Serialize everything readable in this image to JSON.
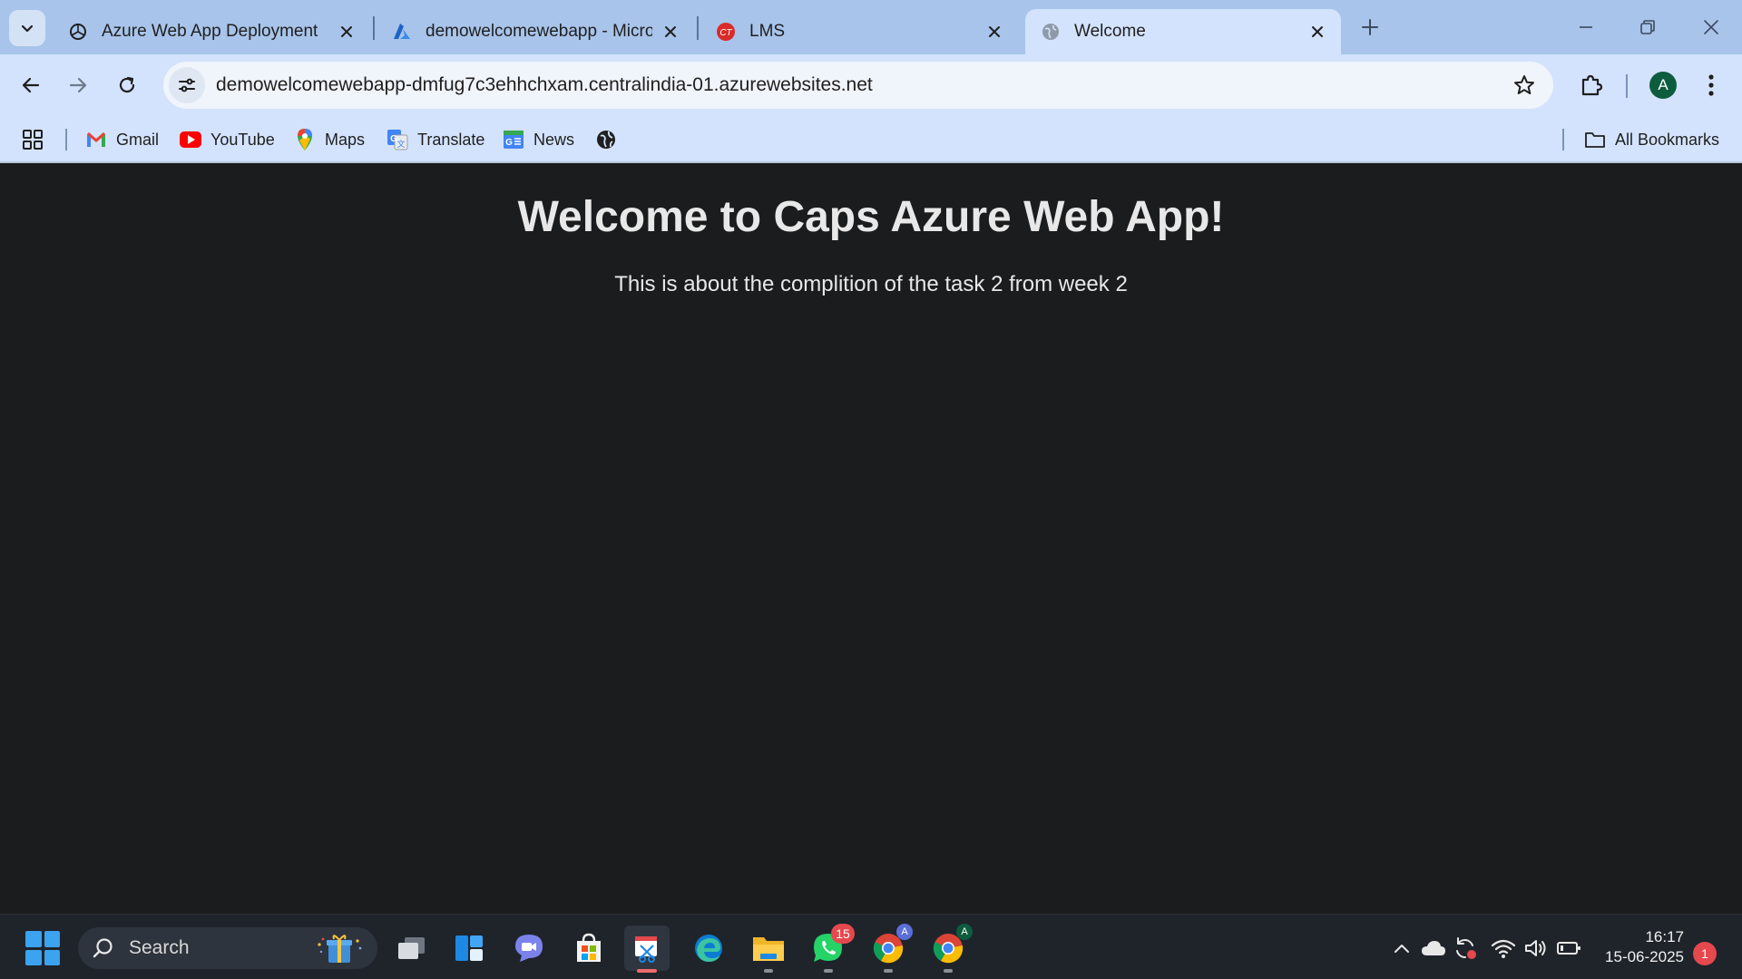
{
  "browser": {
    "tabs": [
      {
        "title": "Azure Web App Deployment",
        "favicon": "openai-icon",
        "active": false
      },
      {
        "title": "demowelcomewebapp - Microsoft Azure",
        "favicon": "azure-icon",
        "active": false
      },
      {
        "title": "LMS",
        "favicon": "lms-icon",
        "active": false
      },
      {
        "title": "Welcome",
        "favicon": "globe-icon",
        "active": true
      }
    ],
    "url": "demowelcomewebapp-dmfug7c3ehhchxam.centralindia-01.azurewebsites.net",
    "profile_initial": "A",
    "bookmarks": [
      {
        "label": "Gmail",
        "icon": "gmail-icon"
      },
      {
        "label": "YouTube",
        "icon": "youtube-icon"
      },
      {
        "label": "Maps",
        "icon": "maps-icon"
      },
      {
        "label": "Translate",
        "icon": "translate-icon"
      },
      {
        "label": "News",
        "icon": "news-icon"
      }
    ],
    "all_bookmarks_label": "All Bookmarks"
  },
  "page": {
    "heading": "Welcome to Caps Azure Web App!",
    "body": "This is about the complition of the task 2 from week 2"
  },
  "taskbar": {
    "search_label": "Search",
    "whatsapp_badge": "15",
    "chrome_profile_1": "A",
    "chrome_profile_2": "A",
    "time": "16:17",
    "date": "15-06-2025",
    "notification_count": "1"
  },
  "colors": {
    "tab_strip": "#a8c4ea",
    "toolbar": "#d3e3fd",
    "page_background": "#1b1c1e",
    "page_text": "#e8e8e8",
    "taskbar": "#1f242b"
  }
}
